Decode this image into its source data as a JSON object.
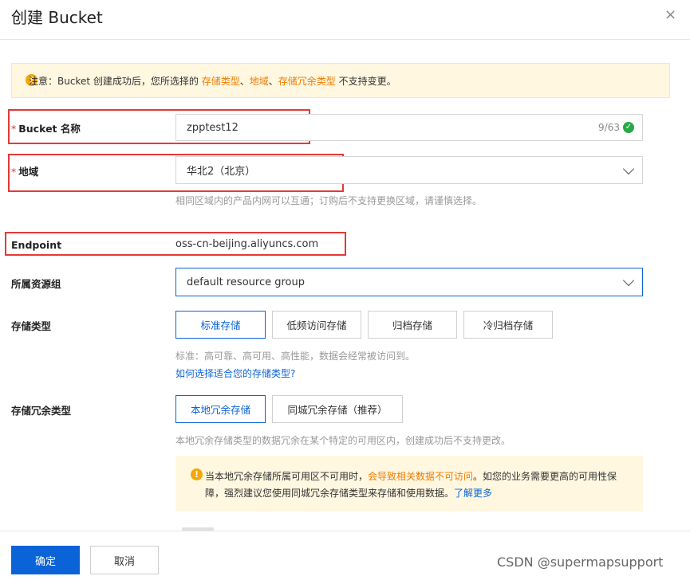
{
  "dialog": {
    "title": "创建 Bucket",
    "close_icon": "×"
  },
  "notice": {
    "prefix": "注意：Bucket 创建成功后，您所选择的 ",
    "hl1": "存储类型",
    "sep1": "、",
    "hl2": "地域",
    "sep2": "、",
    "hl3": "存储冗余类型",
    "suffix": " 不支持变更。"
  },
  "bucket_name": {
    "label": "Bucket 名称",
    "required": "*",
    "value": "zpptest12",
    "counter": "9/63"
  },
  "region": {
    "label": "地域",
    "required": "*",
    "value": "华北2（北京）",
    "help": "相同区域内的产品内网可以互通；订购后不支持更换区域，请谨慎选择。"
  },
  "endpoint": {
    "label": "Endpoint",
    "value": "oss-cn-beijing.aliyuncs.com"
  },
  "resource_group": {
    "label": "所属资源组",
    "value": "default resource group"
  },
  "storage_class": {
    "label": "存储类型",
    "options": [
      "标准存储",
      "低频访问存储",
      "归档存储",
      "冷归档存储"
    ],
    "help": "标准：高可靠、高可用、高性能，数据会经常被访问到。",
    "link": "如何选择适合您的存储类型?"
  },
  "redundancy": {
    "label": "存储冗余类型",
    "options": [
      "本地冗余存储",
      "同城冗余存储（推荐）"
    ],
    "help": "本地冗余存储类型的数据冗余在某个特定的可用区内，创建成功后不支持更改。",
    "tip_part1": "当本地冗余存储所属可用区不可用时，",
    "tip_warn": "会导致相关数据不可访问",
    "tip_part2": "。如您的业务需要更高的可用性保障，强烈建议您使用同城冗余存储类型来存储和使用数据。",
    "tip_link": "了解更多"
  },
  "footer": {
    "confirm": "确定",
    "cancel": "取消"
  },
  "watermark": "CSDN @supermapsupport",
  "colors": {
    "primary": "#0a64d8",
    "warning": "#f07c00",
    "highlight_box": "#e53935",
    "success": "#29a847"
  }
}
